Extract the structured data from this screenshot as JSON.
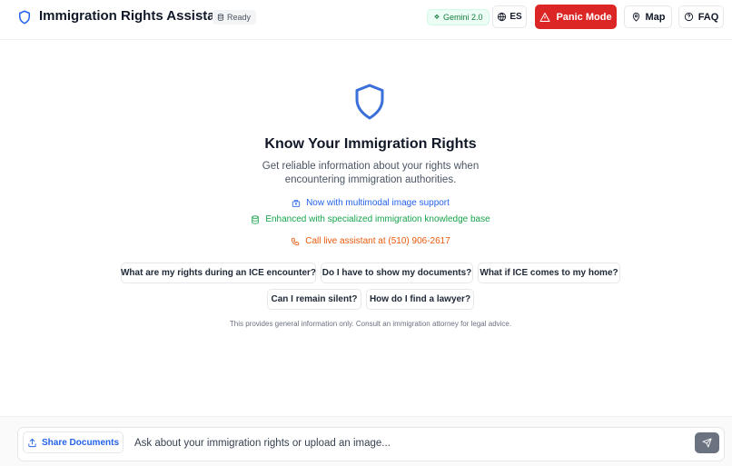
{
  "header": {
    "title": "Immigration Rights Assistant",
    "status_badge": "Ready",
    "model_badge": "Gemini 2.0",
    "language_button": "ES",
    "panic_button": "Panic Mode",
    "map_button": "Map",
    "faq_button": "FAQ"
  },
  "hero": {
    "title": "Know Your Immigration Rights",
    "subtitle": "Get reliable information about your rights when encountering immigration authorities.",
    "features": [
      {
        "icon": "image-icon",
        "text": "Now with multimodal image support",
        "color": "#2563eb"
      },
      {
        "icon": "database-icon",
        "text": "Enhanced with specialized immigration knowledge base",
        "color": "#16a34a"
      },
      {
        "icon": "phone-icon",
        "text": "Call live assistant at (510) 906-2617",
        "color": "#ea580c"
      }
    ]
  },
  "suggestions": [
    "What are my rights during an ICE encounter?",
    "Do I have to show my documents?",
    "What if ICE comes to my home?",
    "Can I remain silent?",
    "How do I find a lawyer?"
  ],
  "disclaimer": "This provides general information only. Consult an immigration attorney for legal advice.",
  "composer": {
    "share_button": "Share Documents",
    "input_placeholder": "Ask about your immigration rights or upload an image...",
    "input_value": ""
  },
  "colors": {
    "accent": "#2563eb",
    "panic": "#dc2626",
    "success": "#16a34a",
    "warning": "#ea580c"
  }
}
